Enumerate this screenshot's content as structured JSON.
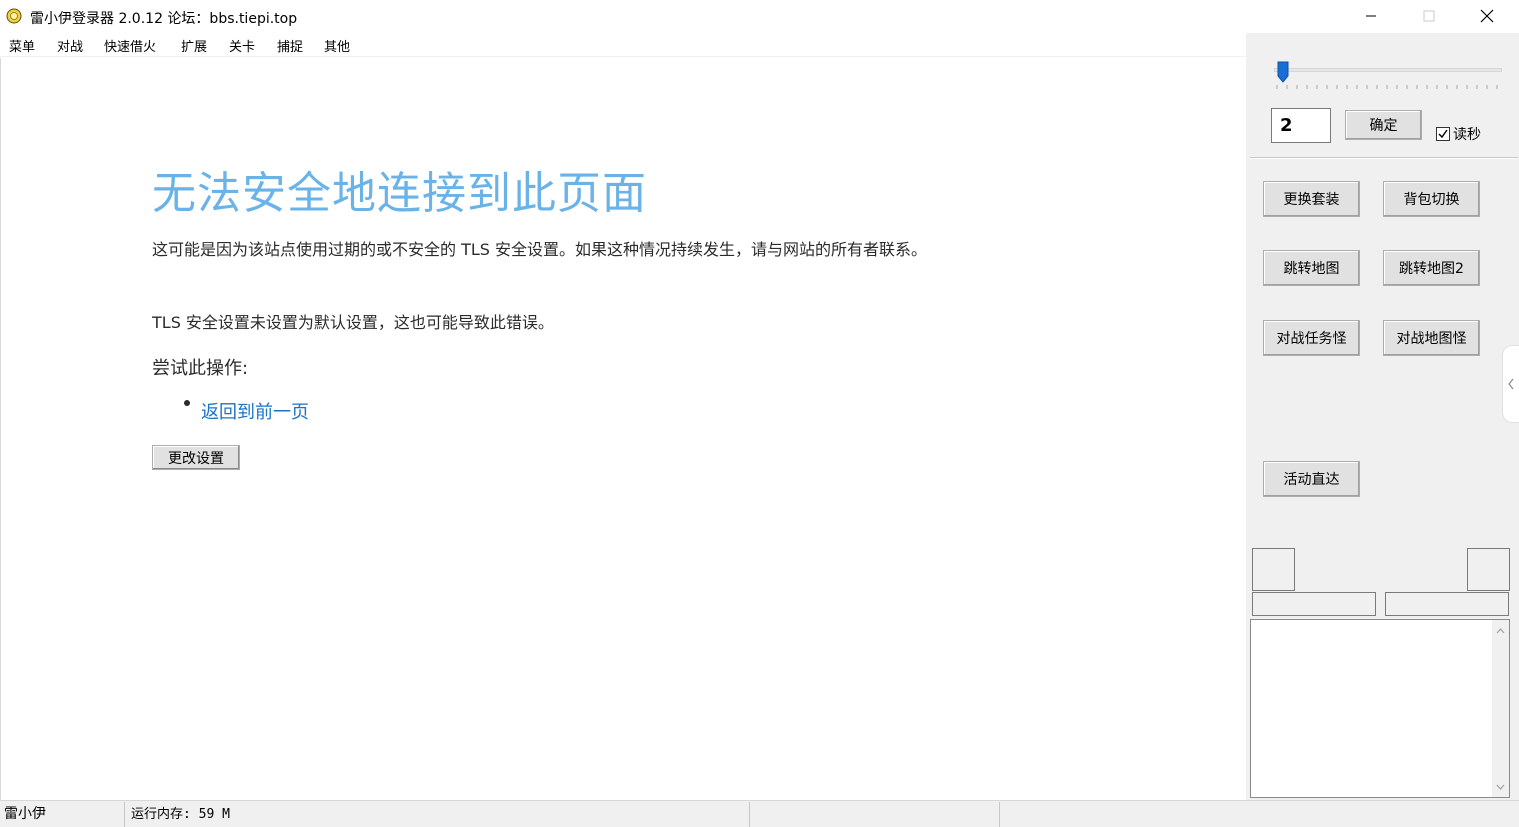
{
  "window": {
    "title": "雷小伊登录器 2.0.12   论坛：bbs.tiepi.top"
  },
  "menu": {
    "items": [
      "菜单",
      "对战",
      "快速借火",
      "扩展",
      "关卡",
      "捕捉",
      "其他"
    ]
  },
  "error_page": {
    "title": "无法安全地连接到此页面",
    "paragraph1": "这可能是因为该站点使用过期的或不安全的 TLS 安全设置。如果这种情况持续发生，请与网站的所有者联系。",
    "paragraph2": "TLS 安全设置未设置为默认设置，这也可能导致此错误。",
    "try_heading": "尝试此操作:",
    "back_link": "返回到前一页",
    "settings_button": "更改设置",
    "title_color": "#6ab3e8",
    "link_color": "#1a73c8"
  },
  "panel": {
    "slider_value": 0,
    "number_value": "2",
    "confirm_button": "确定",
    "read_seconds_label": "读秒",
    "read_seconds_checked": true,
    "buttons": {
      "change_outfit": "更换套装",
      "bag_switch": "背包切换",
      "jump_map": "跳转地图",
      "jump_map2": "跳转地图2",
      "battle_task_monster": "对战任务怪",
      "battle_map_monster": "对战地图怪",
      "activity_direct": "活动直达"
    },
    "slider_color": "#1a6fd4"
  },
  "status": {
    "app_name": "雷小伊",
    "memory": "运行内存: 59 M",
    "cell3": "",
    "cell4": ""
  }
}
